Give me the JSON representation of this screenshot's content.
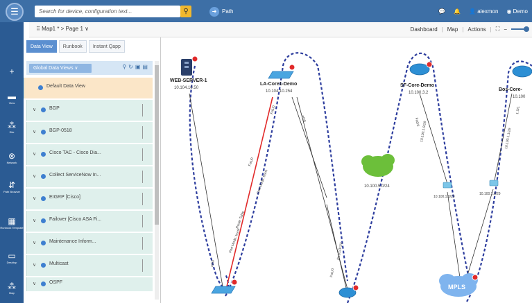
{
  "topbar": {
    "search_placeholder": "Search for device, configuration text...",
    "path_label": "Path",
    "user": "alexmon",
    "demo": "Demo"
  },
  "toolbar": {
    "map_tab": "Map1 * > Page 1 ∨",
    "dashboard": "Dashboard",
    "map": "Map",
    "actions": "Actions"
  },
  "rail": [
    {
      "label": ""
    },
    {
      "label": "View"
    },
    {
      "label": "Site"
    },
    {
      "label": "Network"
    },
    {
      "label": "Path Browser"
    },
    {
      "label": "Runbook Template"
    },
    {
      "label": "Desktop"
    },
    {
      "label": "Map"
    }
  ],
  "panel": {
    "tabs": [
      "Data View",
      "Runbook",
      "Instant Qapp"
    ],
    "global_views": "Global Data Views",
    "items": [
      "Default Data View",
      "BGP",
      "BGP-0518",
      "Cisco TAC - Cisco Dia...",
      "Collect ServiceNow In...",
      "EIGRP [Cisco]",
      "Failover [Cisco ASA Fi...",
      "Maintenance Inform...",
      "Multicast",
      "OSPF"
    ]
  },
  "map": {
    "nodes": {
      "web": {
        "name": "WEB-SERVER-1",
        "ip": "10.104.10.50"
      },
      "la": {
        "name": "LA-Core1-Demo",
        "ip": "10.104.10.254"
      },
      "sf": {
        "name": "SF-Core-Demo",
        "ip": "10.100.3.2"
      },
      "bos": {
        "name": "Bos-Core-",
        "ip": "10.100"
      },
      "cloud": {
        "ip": "10.100.5.0/24"
      },
      "hub1": {
        "ip": "10.100.1.8/29"
      },
      "hub2": {
        "ip": "10.100.1.0/29"
      },
      "mpls": {
        "name": "MPLS"
      }
    },
    "link_labels": {
      "l1": "eth0",
      "l2": "Port Mode: trunk",
      "l3": "Route Table",
      "l4": "Fa1/0",
      "l5": "Port Mode: trunk",
      "l6": "eth0",
      "l7": "Port Mode: trunk",
      "l8": "Fa1/0",
      "l9": "Po1/1/3/1/2",
      "l10": "Fa1/0",
      "l11": "E0/4",
      "l12": "E0/2",
      "l13": "Fa0/0",
      "l14": "1 S/1",
      "l15": "10.100.1.9/29",
      "l16": "10.100.1.1/29"
    }
  }
}
